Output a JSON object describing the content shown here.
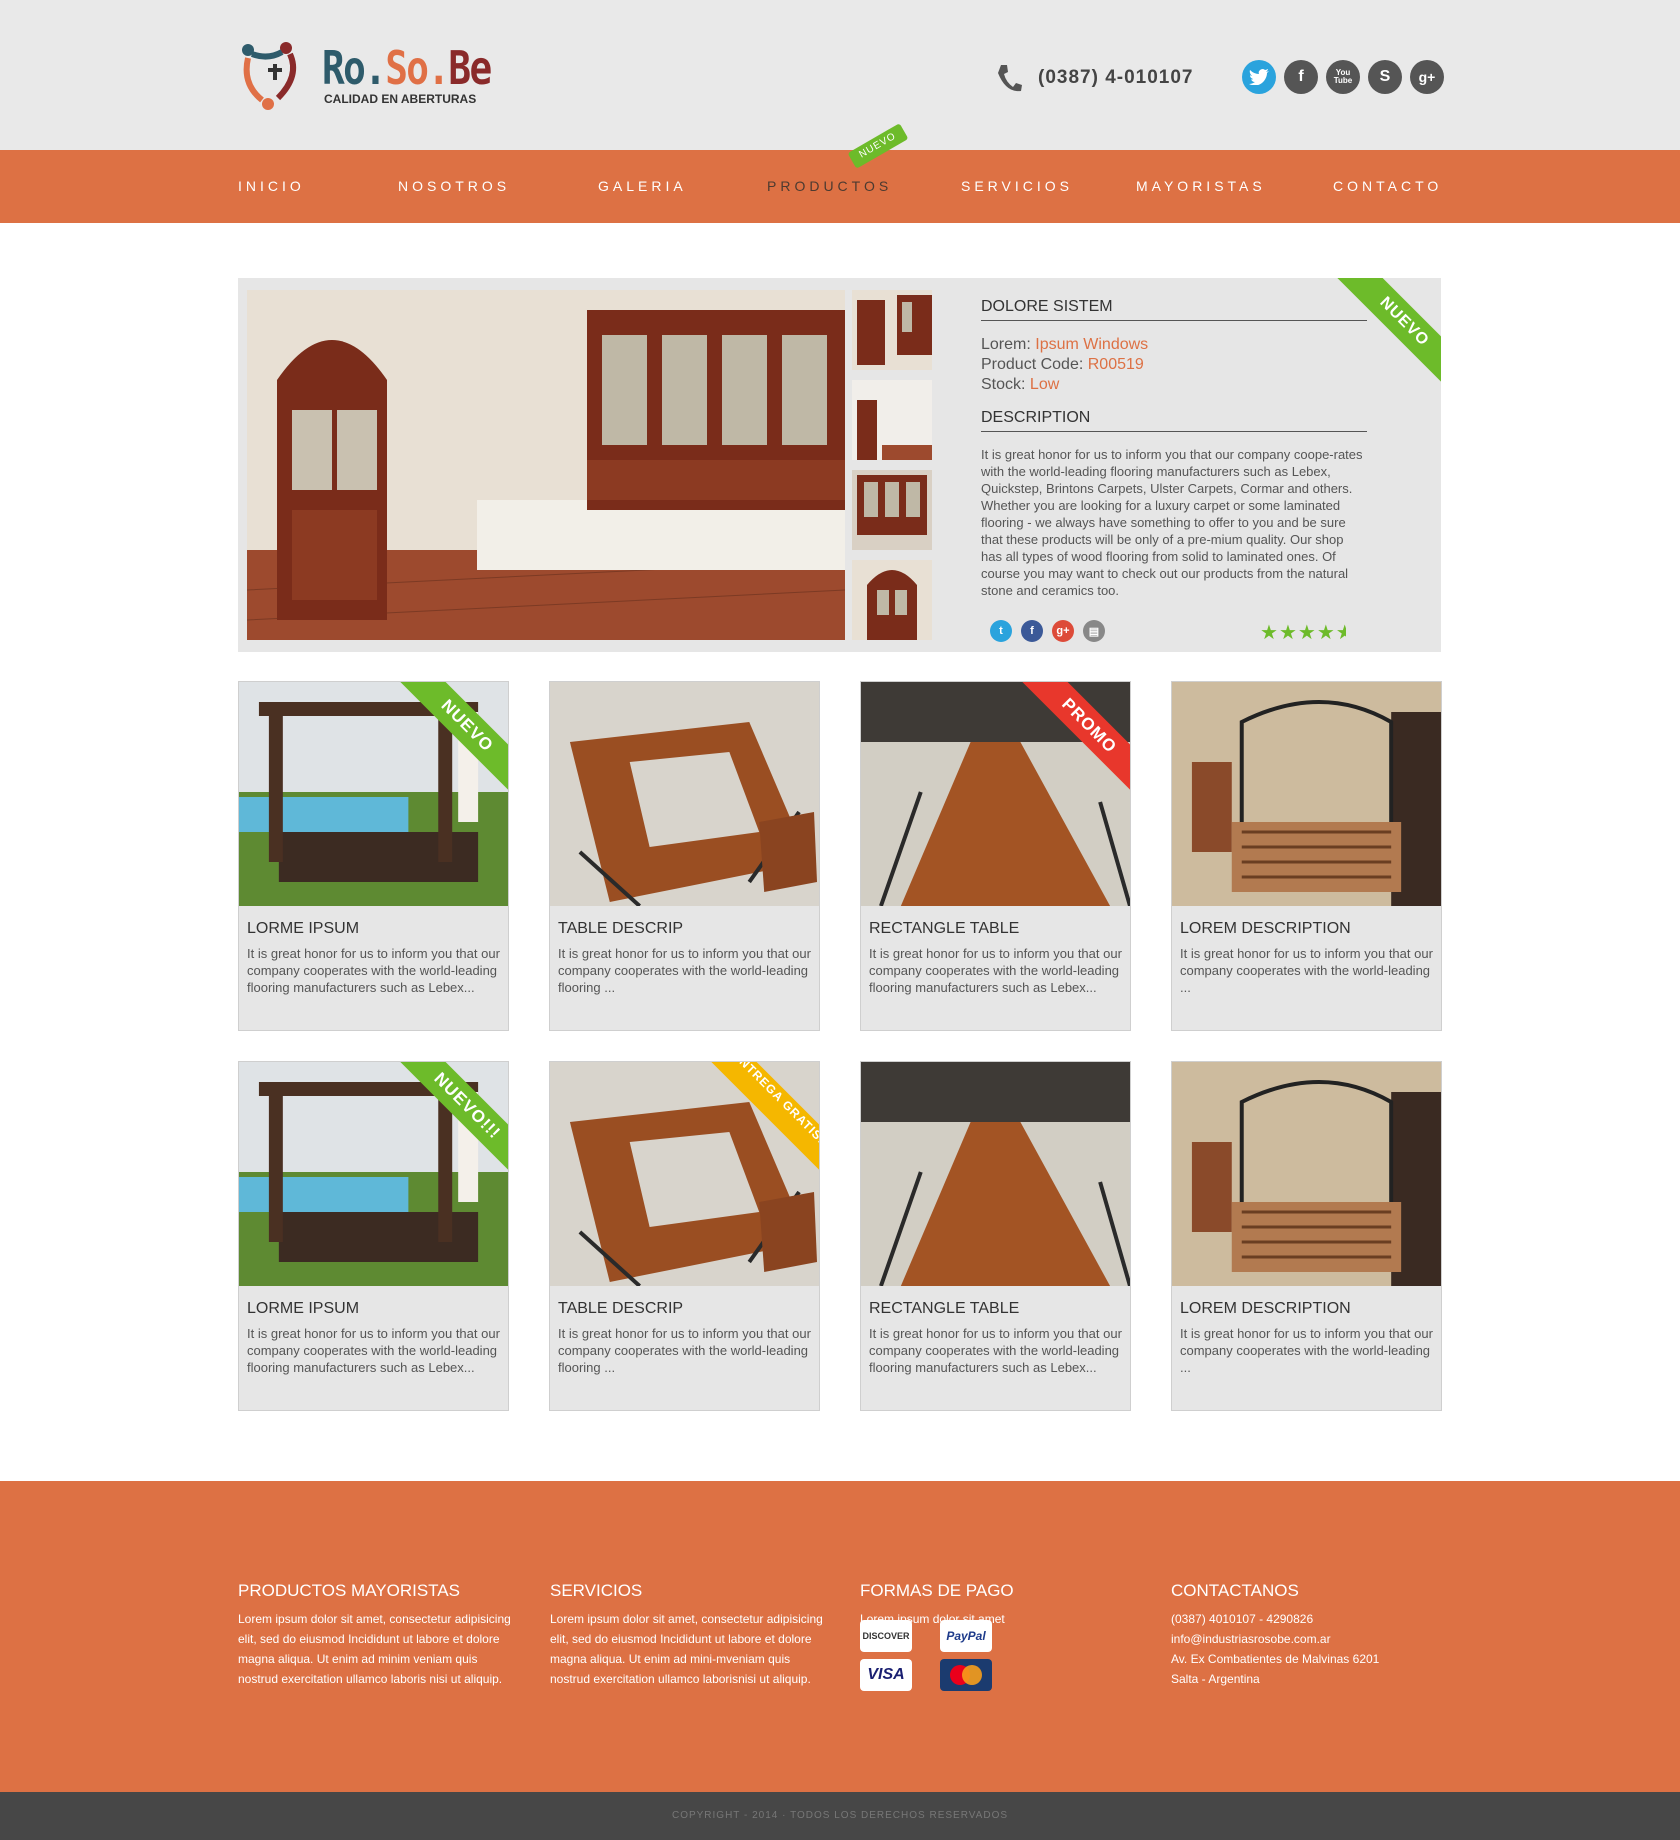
{
  "brand": {
    "name_part1": "Ro.",
    "name_part2": "So.",
    "name_part3": "Be",
    "tagline": "CALIDAD EN ABERTURAS"
  },
  "header": {
    "phone": "(0387) 4-010107",
    "socials": [
      {
        "name": "twitter",
        "glyph": "t",
        "color": "#2aa3dd"
      },
      {
        "name": "facebook",
        "glyph": "f",
        "color": "#555555"
      },
      {
        "name": "youtube",
        "glyph": "You Tube",
        "color": "#555555"
      },
      {
        "name": "skype",
        "glyph": "S",
        "color": "#555555"
      },
      {
        "name": "google-plus",
        "glyph": "g+",
        "color": "#555555"
      }
    ]
  },
  "nav": {
    "items": [
      "INICIO",
      "NOSOTROS",
      "GALERIA",
      "PRODUCTOS",
      "SERVICIOS",
      "MAYORISTAS",
      "CONTACTO"
    ],
    "active": "PRODUCTOS",
    "badge": "NUEVO"
  },
  "colors": {
    "accent": "#dd7144",
    "green": "#6dbb2a",
    "red": "#e8372c",
    "yellow": "#f5b700"
  },
  "product": {
    "title": "DOLORE SISTEM",
    "lorem_label": "Lorem:",
    "lorem_value": "Ipsum Windows",
    "code_label": "Product Code:",
    "code_value": "R00519",
    "stock_label": "Stock:",
    "stock_value": "Low",
    "description_title": "DESCRIPTION",
    "description": "It is great honor for us to inform you that our company coope-rates with the world-leading flooring manufacturers such as Lebex, Quickstep, Brintons Carpets, Ulster Carpets, Cormar and others. Whether you are looking for a luxury carpet or some laminated flooring - we always have something to offer to you and be sure that these products will be only of a pre-mium quality. Our shop has all types of wood flooring from solid to laminated ones. Of course you may want to check out our products from the natural stone and ceramics too.",
    "ribbon": "NUEVO",
    "rating": 4.5,
    "share_icons": [
      "twitter-icon",
      "facebook-icon",
      "google-plus-icon",
      "print-icon"
    ]
  },
  "cards": [
    {
      "title": "LORME IPSUM",
      "text": "It is great honor for us to inform you that our company cooperates with the world-leading flooring manufacturers such as Lebex...",
      "ribbon": "NUEVO",
      "ribbon_color": "#6dbb2a",
      "photo": "pergola"
    },
    {
      "title": "TABLE DESCRIP",
      "text": "It is great honor for us to inform you that our company cooperates with the world-leading flooring ...",
      "ribbon": "",
      "ribbon_color": "",
      "photo": "table"
    },
    {
      "title": "RECTANGLE TABLE",
      "text": "It is great honor for us to inform you that our company cooperates with the world-leading flooring manufacturers such as Lebex...",
      "ribbon": "PROMO",
      "ribbon_color": "#e8372c",
      "photo": "long-table"
    },
    {
      "title": "LOREM DESCRIPTION",
      "text": "It is great honor for us to inform you that our company cooperates with the world-leading ...",
      "ribbon": "",
      "ribbon_color": "",
      "photo": "bed"
    },
    {
      "title": "LORME IPSUM",
      "text": "It is great honor for us to inform you that our company cooperates with the world-leading flooring manufacturers such as Lebex...",
      "ribbon": "NUEVO!!!",
      "ribbon_color": "#6dbb2a",
      "photo": "pergola"
    },
    {
      "title": "TABLE DESCRIP",
      "text": "It is great honor for us to inform you that our company cooperates with the world-leading flooring ...",
      "ribbon": "ENTREGA GRATIS!!!",
      "ribbon_color": "#f5b700",
      "photo": "table"
    },
    {
      "title": "RECTANGLE TABLE",
      "text": "It is great honor for us to inform you that our company cooperates with the world-leading flooring manufacturers such as Lebex...",
      "ribbon": "",
      "ribbon_color": "",
      "photo": "long-table"
    },
    {
      "title": "LOREM DESCRIPTION",
      "text": "It is great honor for us to inform you that our company cooperates with the world-leading ...",
      "ribbon": "",
      "ribbon_color": "",
      "photo": "bed"
    }
  ],
  "footer": {
    "col1_title": "PRODUCTOS MAYORISTAS",
    "col1_text": "Lorem ipsum dolor sit amet, consectetur adipisicing elit, sed do eiusmod Incididunt ut labore et dolore magna aliqua. Ut enim ad minim veniam quis nostrud exercitation ullamco laboris nisi ut aliquip.",
    "col2_title": "SERVICIOS",
    "col2_text": "Lorem ipsum dolor sit amet, consectetur adipisicing elit, sed do eiusmod Incididunt ut labore et dolore magna aliqua. Ut enim ad mini-mveniam quis nostrud exercitation ullamco laborisnisi ut aliquip.",
    "col3_title": "FORMAS DE PAGO",
    "col3_text": "Lorem ipsum dolor sit amet",
    "payments": [
      "DISCOVER",
      "PayPal",
      "VISA",
      "MasterCard"
    ],
    "col4_title": "CONTACTANOS",
    "contact_phone": "(0387) 4010107 - 4290826",
    "contact_email": "info@industriasrosobe.com.ar",
    "contact_address": "Av. Ex Combatientes de Malvinas 6201",
    "contact_city": "Salta - Argentina",
    "copyright": "COPYRIGHT - 2014  ·  TODOS LOS DERECHOS RESERVADOS"
  }
}
